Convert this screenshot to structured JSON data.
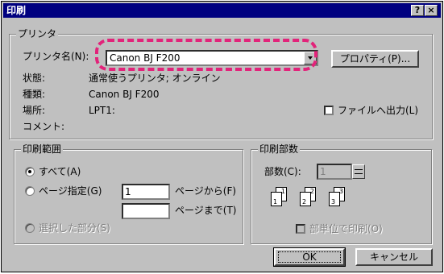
{
  "window": {
    "title": "印刷",
    "help_btn": "?",
    "close_btn": "×"
  },
  "printer": {
    "group_label": "プリンタ",
    "name_label": "プリンタ名(N):",
    "name_value": "Canon BJ F200",
    "properties_button": "プロパティ(P)...",
    "status_label": "状態:",
    "status_value": "通常使うプリンタ; オンライン",
    "type_label": "種類:",
    "type_value": "Canon BJ F200",
    "location_label": "場所:",
    "location_value": "LPT1:",
    "comment_label": "コメント:",
    "print_to_file_label": "ファイルへ出力(L)"
  },
  "print_range": {
    "group_label": "印刷範囲",
    "all_label": "すべて(A)",
    "pages_label": "ページ指定(G)",
    "from_value": "1",
    "from_suffix": "ページから(F)",
    "to_value": "",
    "to_suffix": "ページまで(T)",
    "selection_label": "選択した部分(S)"
  },
  "copies": {
    "group_label": "印刷部数",
    "count_label": "部数(C):",
    "count_value": "1",
    "collate_label": "部単位で印刷(O)",
    "page_icons": [
      {
        "front": "1",
        "back": "1"
      },
      {
        "front": "2",
        "back": "2"
      },
      {
        "front": "3",
        "back": "3"
      }
    ]
  },
  "buttons": {
    "ok": "OK",
    "cancel": "キャンセル"
  },
  "annotation": {
    "color": "#e2237a"
  }
}
